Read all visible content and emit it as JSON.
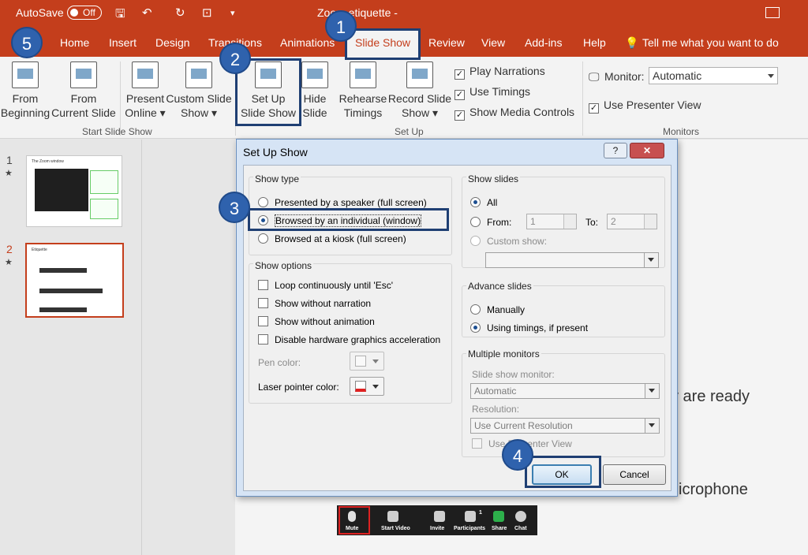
{
  "titlebar": {
    "autosave_label": "AutoSave",
    "autosave_state": "Off",
    "doc_title": "Zoom etiquette -"
  },
  "tabs": [
    "Home",
    "Insert",
    "Design",
    "Transitions",
    "Animations",
    "Slide Show",
    "Review",
    "View",
    "Add-ins",
    "Help"
  ],
  "tell_me": "Tell me what you want to do",
  "ribbon": {
    "from_beginning": [
      "From",
      "Beginning"
    ],
    "from_current": [
      "From",
      "Current Slide"
    ],
    "present_online": [
      "Present",
      "Online ▾"
    ],
    "custom_slide_show": [
      "Custom Slide",
      "Show ▾"
    ],
    "setup_show": [
      "Set Up",
      "Slide Show"
    ],
    "hide_slide": [
      "Hide",
      "Slide"
    ],
    "rehearse": [
      "Rehearse",
      "Timings"
    ],
    "record": [
      "Record Slide",
      "Show ▾"
    ],
    "play_narrations": "Play Narrations",
    "use_timings": "Use Timings",
    "show_media_controls": "Show Media Controls",
    "monitor_label": "Monitor:",
    "monitor_value": "Automatic",
    "use_presenter_view": "Use Presenter View",
    "group_start": "Start Slide Show",
    "group_setup": "Set Up",
    "group_monitors": "Monitors"
  },
  "slides": [
    {
      "num": "1",
      "title": "The Zoom window"
    },
    {
      "num": "2",
      "title": "Etiquette"
    }
  ],
  "background_text": [
    "y are ready",
    "icrophone"
  ],
  "zoom_bar": [
    "Mute",
    "Start Video",
    "Invite",
    "Participants",
    "Share",
    "Chat"
  ],
  "zoom_participants_count": "1",
  "dialog": {
    "title": "Set Up Show",
    "help": "?",
    "close": "✕",
    "show_type": {
      "title": "Show type",
      "options": [
        "Presented by a speaker (full screen)",
        "Browsed by an individual (window)",
        "Browsed at a kiosk (full screen)"
      ],
      "selected": 1
    },
    "show_options": {
      "title": "Show options",
      "items": [
        "Loop continuously until 'Esc'",
        "Show without narration",
        "Show without animation",
        "Disable hardware graphics acceleration"
      ],
      "pen_color": "Pen color:",
      "laser_color": "Laser pointer color:"
    },
    "show_slides": {
      "title": "Show slides",
      "all": "All",
      "from": "From:",
      "from_value": "1",
      "to": "To:",
      "to_value": "2",
      "custom": "Custom show:"
    },
    "advance_slides": {
      "title": "Advance slides",
      "manually": "Manually",
      "timings": "Using timings, if present"
    },
    "multiple_monitors": {
      "title": "Multiple monitors",
      "monitor_label": "Slide show monitor:",
      "monitor_value": "Automatic",
      "resolution_label": "Resolution:",
      "resolution_value": "Use Current Resolution",
      "presenter_view": "Use Presenter View"
    },
    "ok": "OK",
    "cancel": "Cancel"
  },
  "annotations": [
    "1",
    "2",
    "3",
    "4",
    "5"
  ],
  "colors": {
    "brand": "#c43e1c",
    "annotation": "#2f62ad",
    "laser": "#e02020"
  }
}
